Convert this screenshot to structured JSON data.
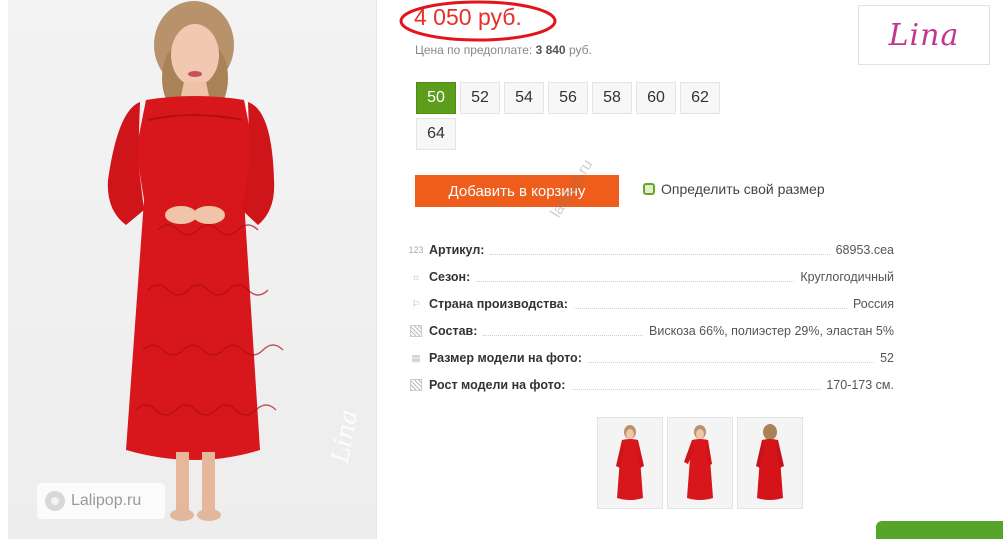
{
  "product": {
    "price": "4 050 руб.",
    "prepay_label": "Цена по предоплате:",
    "prepay_value": "3 840",
    "prepay_currency": "руб.",
    "price_color": "#e5302a"
  },
  "brand": {
    "logo_text": "Lina",
    "color": "#c2378e"
  },
  "photo": {
    "watermark_site": "Lalipop.ru",
    "signature": "Lina"
  },
  "sizes": {
    "options": [
      "50",
      "52",
      "54",
      "56",
      "58",
      "60",
      "62",
      "64"
    ],
    "selected": "50",
    "selected_color": "#5c9d1c"
  },
  "actions": {
    "add_to_cart": "Добавить в корзину",
    "find_size": "Определить свой размер",
    "cart_color": "#ee5d1b"
  },
  "specs": [
    {
      "icon": "123",
      "label": "Артикул:",
      "value": "68953.cea"
    },
    {
      "icon": "sun-icon",
      "label": "Сезон:",
      "value": "Круглогодичный"
    },
    {
      "icon": "flag-icon",
      "label": "Страна производства:",
      "value": "Россия"
    },
    {
      "icon": "fabric-icon",
      "label": "Состав:",
      "value": "Вискоза 66%, полиэстер 29%, эластан 5%"
    },
    {
      "icon": "size-icon",
      "label": "Размер модели на фото:",
      "value": "52"
    },
    {
      "icon": "height-icon",
      "label": "Рост модели на фото:",
      "value": "170-173 см."
    }
  ],
  "thumbnails": [
    "thumb-front-1",
    "thumb-front-2",
    "thumb-back"
  ],
  "watermark_text": "lalipop.ru"
}
